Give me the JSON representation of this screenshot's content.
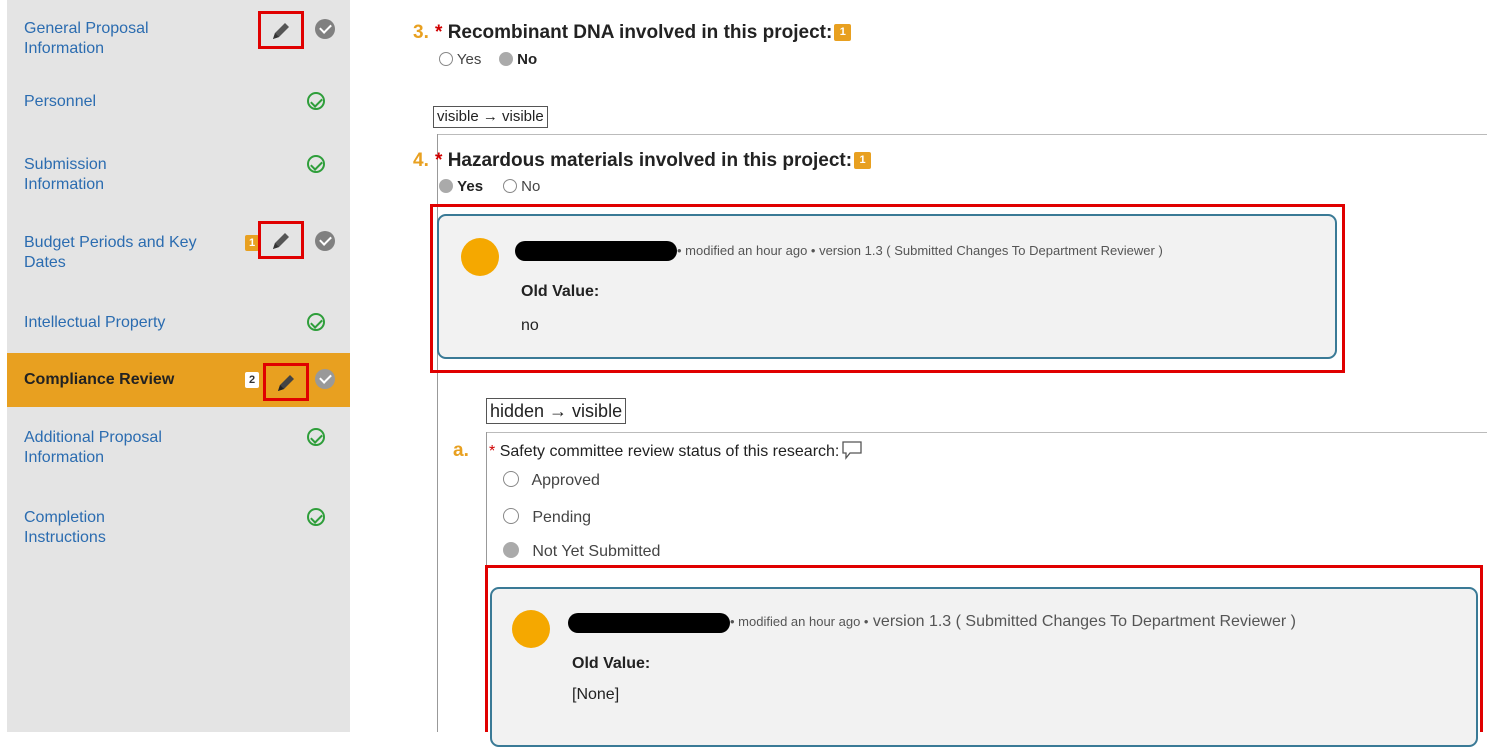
{
  "sidebar": {
    "items": [
      {
        "label": "General Proposal Information"
      },
      {
        "label": "Personnel"
      },
      {
        "label": "Submission Information"
      },
      {
        "label": "Budget Periods and Key Dates",
        "badge": "1"
      },
      {
        "label": "Intellectual Property"
      },
      {
        "label": "Compliance Review",
        "badge": "2"
      },
      {
        "label": "Additional Proposal Information"
      },
      {
        "label": "Completion Instructions"
      }
    ]
  },
  "questions": {
    "q3": {
      "number": "3.",
      "required": "*",
      "text": "Recombinant DNA involved in this project:",
      "comment_count": "1",
      "options": [
        "Yes",
        "No"
      ]
    },
    "q4": {
      "number": "4.",
      "required": "*",
      "text": "Hazardous materials involved in this project:",
      "comment_count": "1",
      "options": [
        "Yes",
        "No"
      ]
    },
    "qa": {
      "number": "a.",
      "required": "*",
      "text": "Safety committee review status of this research:",
      "options": [
        "Approved",
        "Pending",
        "Not Yet Submitted"
      ]
    }
  },
  "diff_tags": {
    "first": "visible → visible",
    "second": "hidden → visible"
  },
  "changes": [
    {
      "meta": "• modified an hour ago • version 1.3 ( Submitted Changes To Department Reviewer )",
      "old_label": "Old Value:",
      "old_value": "no"
    },
    {
      "meta_prefix": "• modified an hour ago •",
      "meta_suffix": "version 1.3 ( Submitted Changes To Department Reviewer )",
      "old_label": "Old Value:",
      "old_value": "[None]"
    }
  ],
  "colors": {
    "accent": "#e8a020",
    "link": "#2b6cb0",
    "highlight": "#e00000",
    "check": "#2e9e3a"
  }
}
